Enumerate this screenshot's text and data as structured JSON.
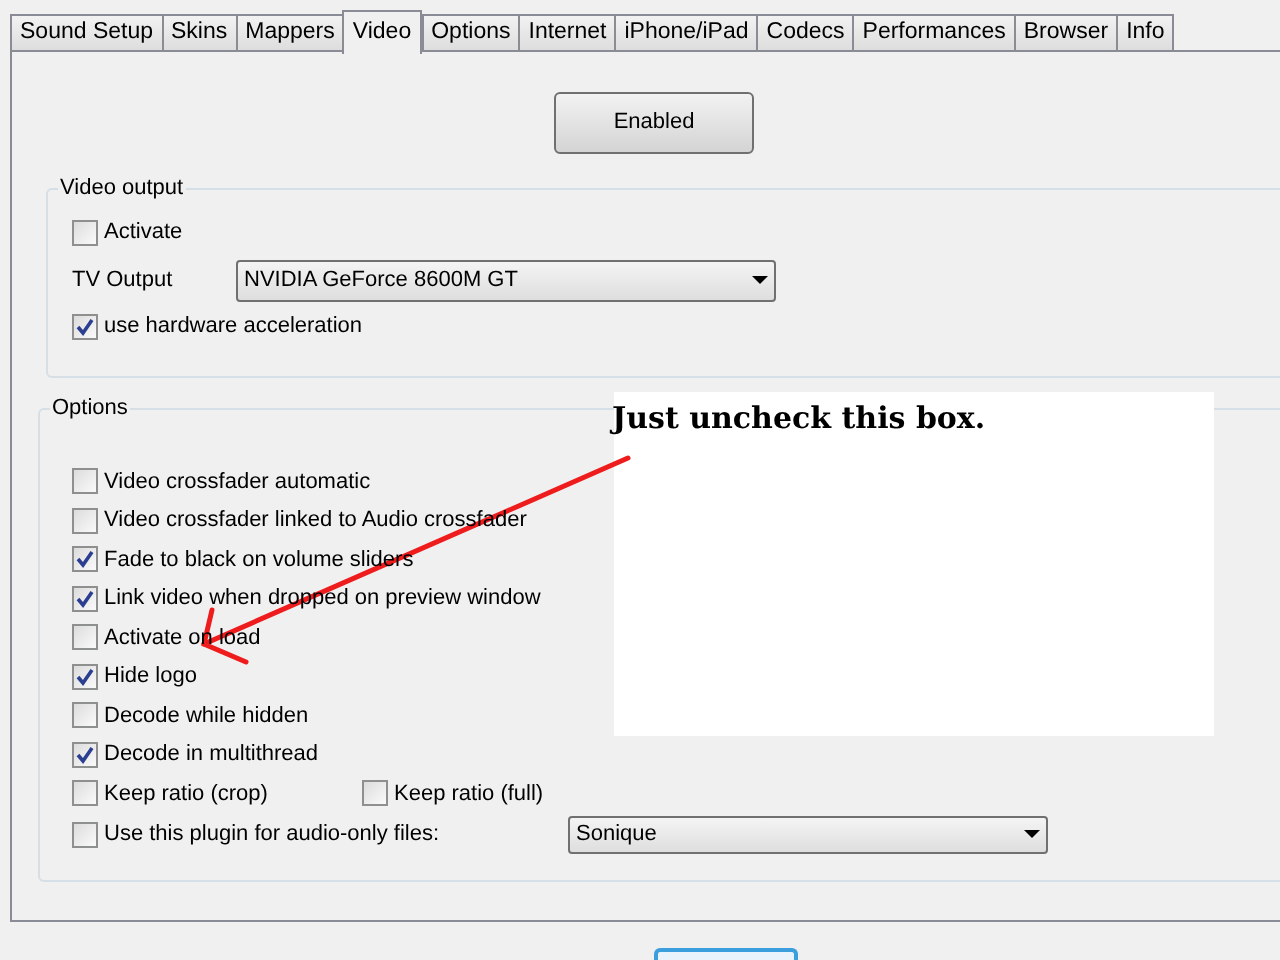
{
  "tabs": [
    {
      "label": "Sound Setup",
      "selected": false
    },
    {
      "label": "Skins",
      "selected": false
    },
    {
      "label": "Mappers",
      "selected": false
    },
    {
      "label": "Video",
      "selected": true
    },
    {
      "label": "Options",
      "selected": false
    },
    {
      "label": "Internet",
      "selected": false
    },
    {
      "label": "iPhone/iPad",
      "selected": false
    },
    {
      "label": "Codecs",
      "selected": false
    },
    {
      "label": "Performances",
      "selected": false
    },
    {
      "label": "Browser",
      "selected": false
    },
    {
      "label": "Info",
      "selected": false
    }
  ],
  "enabled_button": "Enabled",
  "video_output": {
    "title": "Video output",
    "activate": {
      "label": "Activate",
      "checked": false
    },
    "tv_output": {
      "label": "TV Output",
      "value": "NVIDIA GeForce 8600M GT"
    },
    "hardware_acceleration": {
      "label": "use hardware acceleration",
      "checked": true
    }
  },
  "options": {
    "title": "Options",
    "checkboxes": [
      {
        "label": "Video crossfader automatic",
        "checked": false
      },
      {
        "label": "Video crossfader linked to Audio crossfader",
        "checked": false
      },
      {
        "label": "Fade to black on volume sliders",
        "checked": true
      },
      {
        "label": "Link video when dropped on preview window",
        "checked": true
      },
      {
        "label": "Activate on load",
        "checked": false
      },
      {
        "label": "Hide logo",
        "checked": true
      },
      {
        "label": "Decode while hidden",
        "checked": false
      },
      {
        "label": "Decode in multithread",
        "checked": true
      }
    ],
    "keep_ratio": [
      {
        "label": "Keep ratio (crop)",
        "checked": false
      },
      {
        "label": "Keep ratio (full)",
        "checked": false
      }
    ],
    "audio_only_plugin": {
      "label": "Use this plugin for audio-only files:",
      "checked": false,
      "value": "Sonique"
    }
  },
  "annotation": {
    "text": "Just uncheck this box."
  }
}
